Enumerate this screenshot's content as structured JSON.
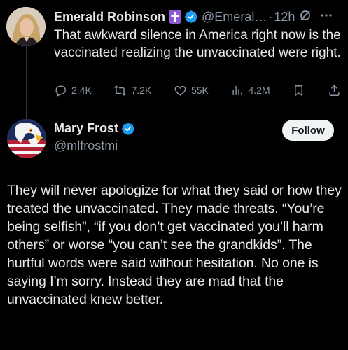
{
  "thread_tweet": {
    "author_name": "Emerald Robinson",
    "handle": "@Emeral…",
    "separator": "·",
    "time": "12h",
    "text": "That awkward silence in America right now is the vaccinated realizing the unvaccinated were right.",
    "metrics": {
      "replies": "2.4K",
      "retweets": "7.2K",
      "likes": "55K",
      "views": "4.2M"
    }
  },
  "main_tweet": {
    "author_name": "Mary Frost",
    "handle": "@mlfrostmi",
    "follow_label": "Follow",
    "text": "They will never apologize for what they said or how they treated the unvaccinated. They made threats. “You’re being selfish”,  “if you don’t get vaccinated you’ll harm others” or worse “you can’t see the grandkids”.  The hurtful words were said without hesitation. No one is saying I’m sorry. Instead they are mad that the unvaccinated knew better."
  },
  "colors": {
    "background": "#000000",
    "text": "#e7e9ea",
    "secondary_text": "#8b98a5",
    "verified_blue": "#1d9bf0",
    "cross_badge": "#8d5bd1"
  },
  "icons": [
    "reply-icon",
    "retweet-icon",
    "like-icon",
    "views-icon",
    "bookmark-icon",
    "share-icon",
    "grok-icon",
    "more-icon",
    "verified-icon",
    "cross-icon"
  ]
}
